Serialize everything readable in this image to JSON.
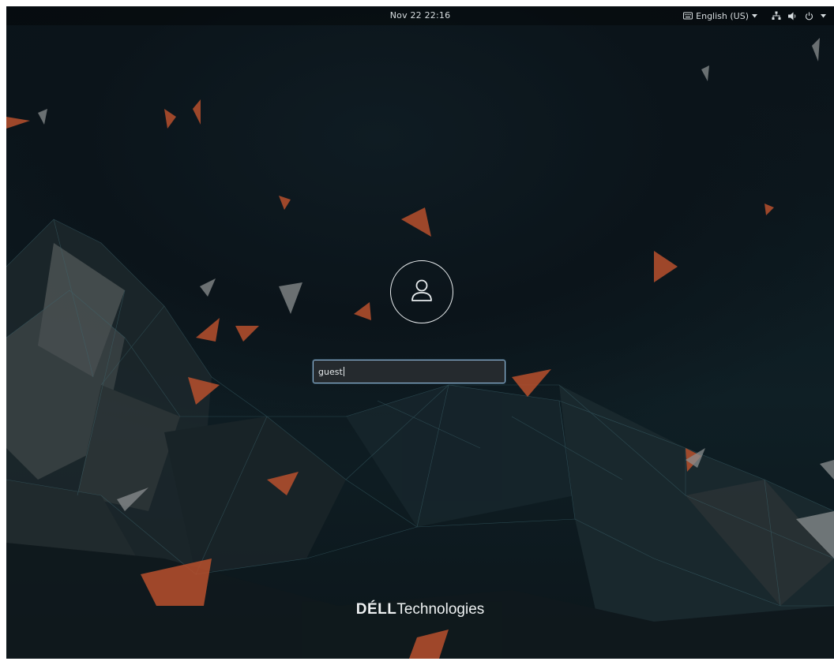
{
  "topbar": {
    "clock": "Nov 22  22:16",
    "keyboard_layout": "English (US)"
  },
  "login": {
    "username_value": "guest"
  },
  "logo": {
    "brand": "DÉLL",
    "suffix": "Technologies"
  },
  "icons": {
    "keyboard": "keyboard-icon",
    "network": "network-icon",
    "volume": "volume-icon",
    "power": "power-icon",
    "user": "user-icon"
  },
  "colors": {
    "background": "#0c161b",
    "input_border": "#8fb6d6",
    "accent_orange": "#c8552f"
  }
}
